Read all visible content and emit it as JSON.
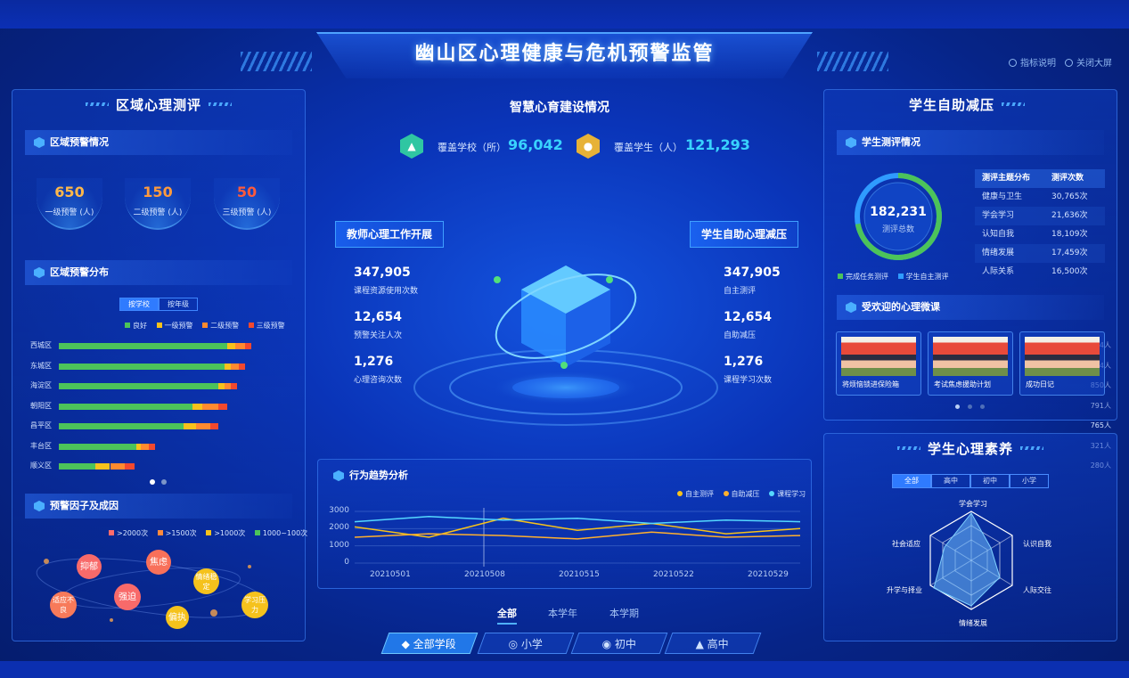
{
  "header": {
    "title": "幽山区心理健康与危机预警监管",
    "links": [
      {
        "label": "指标说明",
        "icon": "help-icon"
      },
      {
        "label": "关闭大屏",
        "icon": "close-icon"
      }
    ]
  },
  "left": {
    "panel_title": "区域心理测评",
    "warning": {
      "title": "区域预警情况",
      "cards": [
        {
          "value": "650",
          "label": "一级预警 (人)",
          "color": "#ffb84a"
        },
        {
          "value": "150",
          "label": "二级预警 (人)",
          "color": "#ff9a3d"
        },
        {
          "value": "50",
          "label": "三级预警 (人)",
          "color": "#ff5a3c"
        }
      ]
    },
    "distribution": {
      "title": "区域预警分布",
      "toggles": [
        "按学校",
        "按年级"
      ],
      "legend": [
        {
          "label": "良好",
          "color": "#4cc35a"
        },
        {
          "label": "一级预警",
          "color": "#f7c21b"
        },
        {
          "label": "二级预警",
          "color": "#ff8a2f"
        },
        {
          "label": "三级预警",
          "color": "#f2492e"
        }
      ],
      "rows": [
        {
          "name": "西城区",
          "value": "1,234人",
          "segments": [
            0.82,
            0.04,
            0.05,
            0.03
          ]
        },
        {
          "name": "东城区",
          "value": "934人",
          "segments": [
            0.81,
            0.03,
            0.04,
            0.03
          ]
        },
        {
          "name": "海淀区",
          "value": "850人",
          "segments": [
            0.78,
            0.03,
            0.03,
            0.03
          ]
        },
        {
          "name": "朝阳区",
          "value": "791人",
          "segments": [
            0.65,
            0.05,
            0.08,
            0.04
          ]
        },
        {
          "name": "昌平区",
          "value": "765人",
          "segments": [
            0.61,
            0.06,
            0.07,
            0.04
          ]
        },
        {
          "name": "丰台区",
          "value": "321人",
          "segments": [
            0.38,
            0.02,
            0.04,
            0.03
          ]
        },
        {
          "name": "顺义区",
          "value": "280人",
          "segments": [
            0.18,
            0.07,
            0.07,
            0.05
          ]
        }
      ]
    },
    "factors": {
      "title": "预警因子及成因",
      "legend": [
        {
          "label": ">2000次",
          "color": "#ff6b6b"
        },
        {
          "label": ">1500次",
          "color": "#ff8a3d"
        },
        {
          "label": ">1000次",
          "color": "#f7c21b"
        },
        {
          "label": "1000~100次",
          "color": "#4cc35a"
        }
      ],
      "bubbles": [
        {
          "label": "抑郁",
          "color": "#f86a6a"
        },
        {
          "label": "焦虑",
          "color": "#f8705a"
        },
        {
          "label": "情绪稳定",
          "color": "#f5c21c"
        },
        {
          "label": "强迫",
          "color": "#f86a6a"
        },
        {
          "label": "适应不良",
          "color": "#f77a5a"
        },
        {
          "label": "偏执",
          "color": "#f5c21c"
        },
        {
          "label": "学习压力",
          "color": "#f5c21c"
        }
      ]
    }
  },
  "center": {
    "section_title": "智慧心育建设情况",
    "cover": [
      {
        "label": "覆盖学校（所）",
        "value": "96,042",
        "icon": "school-icon",
        "color": "#2fc6a2"
      },
      {
        "label": "覆盖学生（人）",
        "value": "121,293",
        "icon": "students-icon",
        "color": "#e7b237"
      }
    ],
    "teacher": {
      "title": "教师心理工作开展",
      "stats": [
        {
          "value": "347,905",
          "label": "课程资源使用次数"
        },
        {
          "value": "12,654",
          "label": "预警关注人次"
        },
        {
          "value": "1,276",
          "label": "心理咨询次数"
        }
      ]
    },
    "student": {
      "title": "学生自助心理减压",
      "stats": [
        {
          "value": "347,905",
          "label": "自主测评"
        },
        {
          "value": "12,654",
          "label": "自助减压"
        },
        {
          "value": "1,276",
          "label": "课程学习次数"
        }
      ]
    },
    "trend": {
      "title": "行为趋势分析",
      "legend": [
        {
          "label": "自主测评",
          "color": "#f7c21b"
        },
        {
          "label": "自助减压",
          "color": "#ffb02e"
        },
        {
          "label": "课程学习",
          "color": "#55d8ff"
        }
      ]
    },
    "period_tabs": [
      "全部",
      "本学年",
      "本学期"
    ],
    "stage_buttons": [
      {
        "label": "全部学段",
        "icon": "cube-icon"
      },
      {
        "label": "小学",
        "icon": "bulb-icon"
      },
      {
        "label": "初中",
        "icon": "person-icon"
      },
      {
        "label": "高中",
        "icon": "graduate-icon"
      }
    ]
  },
  "right": {
    "relief": {
      "panel_title": "学生自助减压",
      "eval_title": "学生测评情况",
      "ring_value": "182,231",
      "ring_label": "测评总数",
      "ring_done_fraction": 0.72,
      "ring_legend": [
        {
          "label": "完成任务测评",
          "color": "#4cc35a"
        },
        {
          "label": "学生自主测评",
          "color": "#2f9bff"
        }
      ],
      "table_headers": [
        "测评主题分布",
        "测评次数"
      ],
      "table_rows": [
        [
          "健康与卫生",
          "30,765次"
        ],
        [
          "学会学习",
          "21,636次"
        ],
        [
          "认知自我",
          "18,109次"
        ],
        [
          "情绪发展",
          "17,459次"
        ],
        [
          "人际关系",
          "16,500次"
        ]
      ],
      "courses_title": "受欢迎的心理微课",
      "courses": [
        "将烦恼锁进保险箱",
        "考试焦虑援助计划",
        "成功日记"
      ]
    },
    "literacy": {
      "panel_title": "学生心理素养",
      "tabs": [
        "全部",
        "高中",
        "初中",
        "小学"
      ],
      "radar_axes": [
        "学会学习",
        "认识自我",
        "人际交往",
        "情绪发展",
        "升学与择业",
        "社会适应"
      ]
    }
  },
  "chart_data": {
    "type": "line",
    "title": "行为趋势分析",
    "x": [
      "20210501",
      "20210508",
      "20210515",
      "20210522",
      "20210529"
    ],
    "ylim": [
      0,
      3000
    ],
    "yticks": [
      0,
      1000,
      2000,
      3000
    ],
    "series": [
      {
        "name": "自主测评",
        "color": "#f7c21b",
        "values": [
          2100,
          1500,
          2600,
          1900,
          2300,
          1700,
          2000
        ]
      },
      {
        "name": "自助减压",
        "color": "#ffb02e",
        "values": [
          1500,
          1700,
          1600,
          1400,
          1800,
          1500,
          1600
        ]
      },
      {
        "name": "课程学习",
        "color": "#55d8ff",
        "values": [
          2400,
          2700,
          2500,
          2600,
          2300,
          2500,
          2400
        ]
      }
    ]
  }
}
